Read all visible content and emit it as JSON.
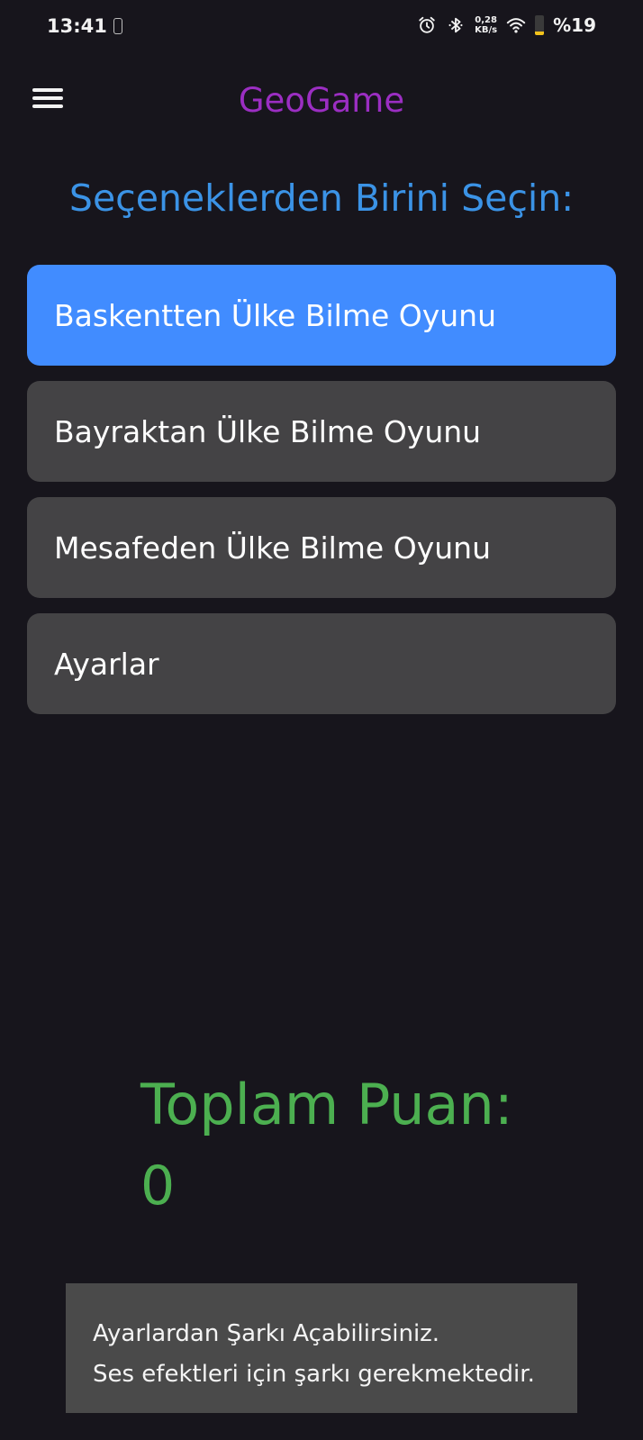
{
  "status_bar": {
    "time": "13:41",
    "net_speed_value": "0,28",
    "net_speed_unit": "KB/s",
    "battery_label": "%19",
    "battery_level": 0.19,
    "icons": [
      "phone-outline-icon",
      "alarm-icon",
      "bluetooth-icon",
      "wifi-icon",
      "battery-icon"
    ]
  },
  "app_bar": {
    "title": "GeoGame",
    "title_color": "#9b2ec2",
    "menu_icon": "hamburger-menu-icon"
  },
  "main": {
    "prompt": "Seçeneklerden Birini Seçin:",
    "prompt_color": "#3b93e6",
    "options": [
      {
        "label": "Baskentten Ülke Bilme Oyunu",
        "selected": true
      },
      {
        "label": "Bayraktan Ülke Bilme Oyunu",
        "selected": false
      },
      {
        "label": "Mesafeden Ülke Bilme Oyunu",
        "selected": false
      },
      {
        "label": "Ayarlar",
        "selected": false
      }
    ],
    "selected_color": "#418cff",
    "option_color": "#444345"
  },
  "score": {
    "label": "Toplam Puan:",
    "value": "0",
    "color": "#4caf50"
  },
  "toast": {
    "line1": "Ayarlardan Şarkı Açabilirsiniz.",
    "line2": "Ses efektleri için şarkı gerekmektedir."
  }
}
